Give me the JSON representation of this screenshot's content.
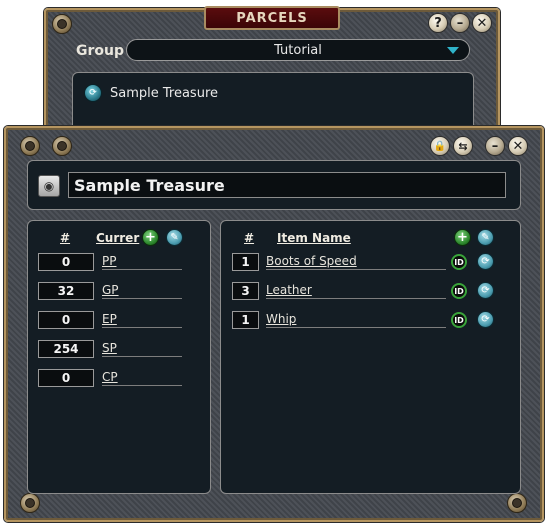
{
  "parcels_window": {
    "title": "PARCELS",
    "group_label": "Group",
    "group_value": "Tutorial",
    "items": [
      {
        "label": "Sample Treasure"
      }
    ],
    "buttons": {
      "help": "?",
      "minimize": "–",
      "close": "✕"
    }
  },
  "treasure_window": {
    "name": "Sample Treasure",
    "buttons": {
      "lock": "🔒",
      "share": "⇆",
      "minimize": "–",
      "close": "✕"
    },
    "coins": {
      "hdr_num": "#",
      "hdr_label": "Currer",
      "rows": [
        {
          "amount": "0",
          "name": "PP"
        },
        {
          "amount": "32",
          "name": "GP"
        },
        {
          "amount": "0",
          "name": "EP"
        },
        {
          "amount": "254",
          "name": "SP"
        },
        {
          "amount": "0",
          "name": "CP"
        }
      ]
    },
    "items": {
      "hdr_num": "#",
      "hdr_label": "Item Name",
      "rows": [
        {
          "count": "1",
          "name": "Boots of Speed"
        },
        {
          "count": "3",
          "name": "Leather"
        },
        {
          "count": "1",
          "name": "Whip"
        }
      ]
    },
    "add_label": "+",
    "id_label": "ID"
  },
  "colors": {
    "frame_gold": "#b59560",
    "panel_bg": "#141d24",
    "title_red": "#5a0c0e",
    "add_green": "#2f8a2f",
    "edit_blue": "#4c9db0",
    "caret_cyan": "#2fb3c9"
  }
}
